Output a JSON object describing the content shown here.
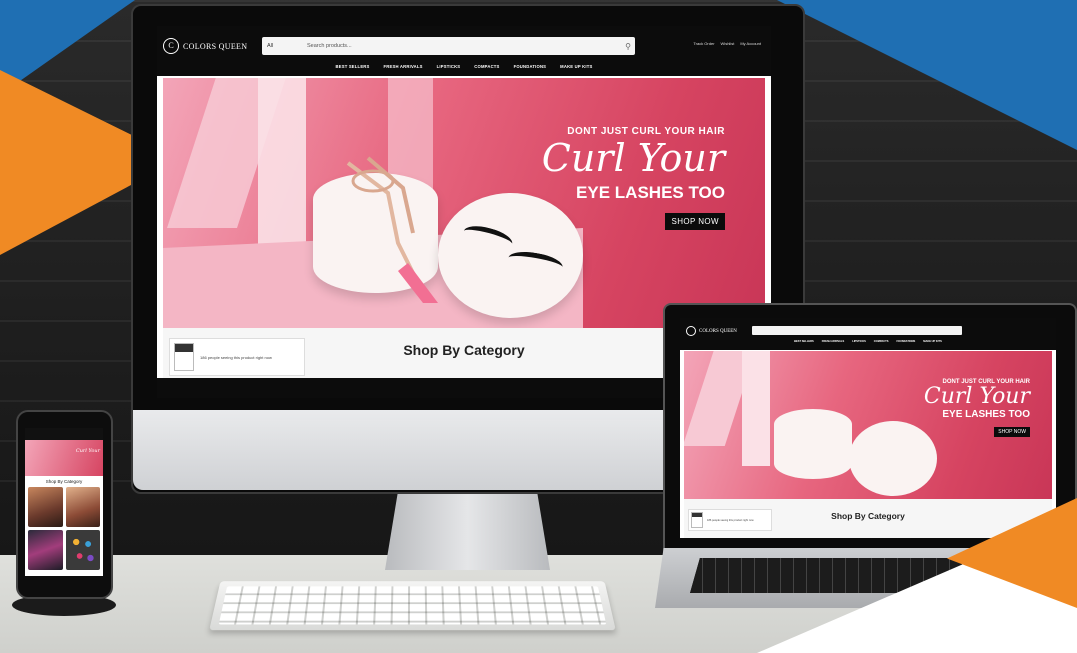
{
  "brand": {
    "name": "COLORS QUEEN",
    "logo_letter": "C"
  },
  "colors": {
    "accent_blue": "#1f6fb3",
    "accent_orange": "#f08a24",
    "hero_pink": "#d64461",
    "header_black": "#0c0c0c"
  },
  "header": {
    "search_category": "All",
    "search_placeholder": "Search products...",
    "links": [
      "Track Order",
      "Wishlist",
      "My Account"
    ]
  },
  "nav": {
    "items": [
      "BEST SELLERS",
      "FRESH ARRIVALS",
      "LIPSTICKS",
      "COMPACTS",
      "FOUNDATIONS",
      "MAKE UP KITS"
    ]
  },
  "hero": {
    "tagline": "DONT JUST CURL YOUR HAIR",
    "script": "Curl Your",
    "headline": "EYE LASHES TOO",
    "cta": "SHOP NOW"
  },
  "section": {
    "title": "Shop By Category"
  },
  "notification": {
    "text": "186 people seeing this product right now"
  },
  "icons": {
    "search": "search-icon",
    "cart": "cart-icon",
    "heart": "heart-icon",
    "user": "user-icon"
  }
}
